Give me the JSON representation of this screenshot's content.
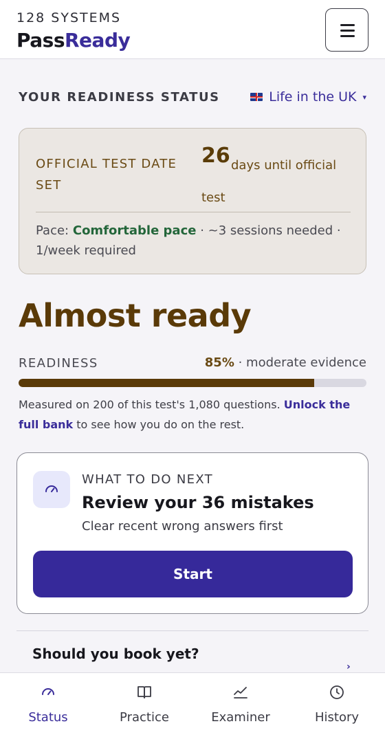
{
  "header": {
    "company": "128 SYSTEMS",
    "brand_part1": "Pass",
    "brand_part2": "Ready",
    "menu_icon": "hamburger-menu-icon"
  },
  "status": {
    "section_title": "YOUR READINESS STATUS",
    "test_name": "Life in the UK",
    "test_flag_icon": "uk-flag-icon"
  },
  "date_card": {
    "label": "OFFICIAL TEST DATE SET",
    "days": "26",
    "days_text": "days until official test",
    "pace_prefix": "Pace:",
    "pace_value": "Comfortable pace",
    "pace_suffix": "· ~3 sessions needed · 1/week required"
  },
  "readiness": {
    "headline": "Almost ready",
    "label": "READINESS",
    "percent_text": "85%",
    "evidence": "· moderate evidence",
    "progress_fraction": 0.85,
    "measured_text": "Measured on 200 of this test's 1,080 questions.",
    "unlock_link": "Unlock the full bank",
    "measured_suffix": "to see how you do on the rest."
  },
  "next": {
    "icon": "gauge-icon",
    "eyebrow": "WHAT TO DO NEXT",
    "title": "Review your 36 mistakes",
    "subtitle": "Clear recent wrong answers first",
    "button": "Start"
  },
  "book": {
    "question": "Should you book yet?"
  },
  "nav": {
    "items": [
      {
        "label": "Status",
        "icon": "gauge-icon",
        "active": true
      },
      {
        "label": "Practice",
        "icon": "book-icon",
        "active": false
      },
      {
        "label": "Examiner",
        "icon": "chart-line-icon",
        "active": false
      },
      {
        "label": "History",
        "icon": "clock-icon",
        "active": false
      }
    ]
  },
  "colors": {
    "accent": "#36299a",
    "brown": "#5a3a08",
    "green": "#23663a",
    "card_bg": "#ebe7e3"
  }
}
